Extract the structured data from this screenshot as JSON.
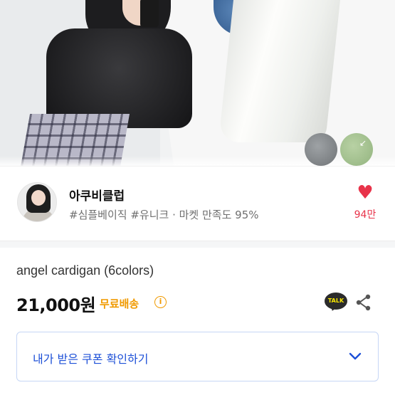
{
  "seller": {
    "name": "아쿠비클럽",
    "tags": "#심플베이직 #유니크 · 마켓 만족도 95%",
    "likes": "94만"
  },
  "product": {
    "title": "angel cardigan (6colors)",
    "price": "21,000원",
    "shipping": "무료배송",
    "info_glyph": "i",
    "talk_label": "TALK",
    "swatches": [
      {
        "color": "#83878a"
      },
      {
        "color": "#a7c493"
      }
    ]
  },
  "coupon": {
    "label": "내가 받은 쿠폰 확인하기"
  },
  "colors": {
    "like": "#e8334a",
    "shipping": "#f09a00",
    "coupon_text": "#1c4fd7",
    "coupon_border": "#c6d6f5"
  }
}
